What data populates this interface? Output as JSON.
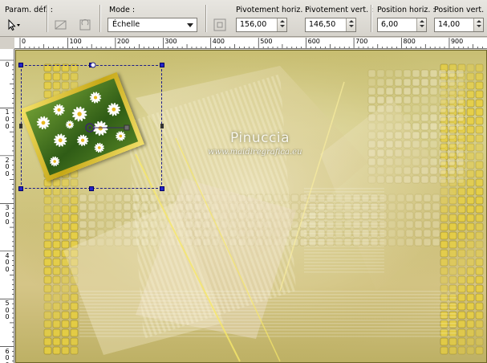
{
  "toolbar": {
    "preset_label": "Param. déf. :",
    "mode_label": "Mode :",
    "mode_value": "Échelle",
    "pivot_h_label": "Pivotement horiz. :",
    "pivot_h_value": "156,00",
    "pivot_v_label": "Pivotement vert. :",
    "pivot_v_value": "146,50",
    "pos_h_label": "Position horiz. :",
    "pos_h_value": "6,00",
    "pos_v_label": "Position vert. :",
    "pos_v_value": "14,00"
  },
  "ruler_h": [
    "0",
    "100",
    "200",
    "300",
    "400",
    "500",
    "600",
    "700",
    "800",
    "900"
  ],
  "ruler_v": [
    "0",
    "1\n0\n0",
    "2\n0\n0",
    "3\n0\n0",
    "4\n0\n0",
    "5\n0\n0",
    "6\n0\n0"
  ],
  "canvas": {
    "watermark_title": "Pinuccia",
    "watermark_url": "www.maidiregrafica.eu"
  },
  "colors": {
    "selection_handle": "#2424c8",
    "frame_gold": "#c7a816",
    "tile_yellow": "#e8cf3c"
  }
}
